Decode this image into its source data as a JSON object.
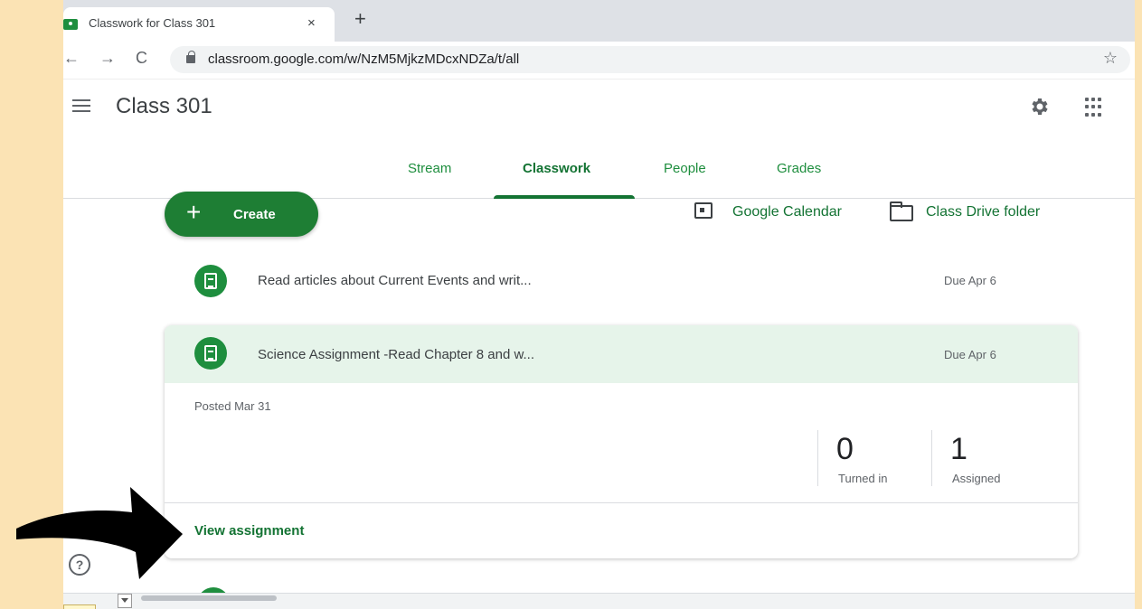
{
  "browser": {
    "tab_title": "Classwork for Class 301",
    "tab_close": "×",
    "new_tab": "+",
    "back": "←",
    "forward": "→",
    "reload": "C",
    "url": "classroom.google.com/w/NzM5MjkzMDcxNDZa/t/all",
    "star": "☆"
  },
  "header": {
    "class_title": "Class 301",
    "tabs": [
      {
        "label": "Stream"
      },
      {
        "label": "Classwork"
      },
      {
        "label": "People"
      },
      {
        "label": "Grades"
      }
    ],
    "active_tab": "Classwork"
  },
  "toolbar": {
    "create_label": "Create",
    "create_plus": "+",
    "calendar_label": "Google Calendar",
    "drive_label": "Class Drive folder"
  },
  "items": [
    {
      "title": "Read articles about Current Events and writ...",
      "due": "Due Apr 6"
    },
    {
      "title": "Science Assignment -Read Chapter 8 and w...",
      "due": "Due Apr 6"
    }
  ],
  "card": {
    "posted": "Posted Mar 31",
    "turned_in_count": "0",
    "turned_in_label": "Turned in",
    "assigned_count": "1",
    "assigned_label": "Assigned",
    "view_link": "View assignment"
  },
  "help": "?",
  "colors": {
    "accent_green": "#1e8e3e",
    "dark_green": "#137333",
    "card_highlight": "#e6f4ea",
    "page_background": "#fbe3b4"
  }
}
